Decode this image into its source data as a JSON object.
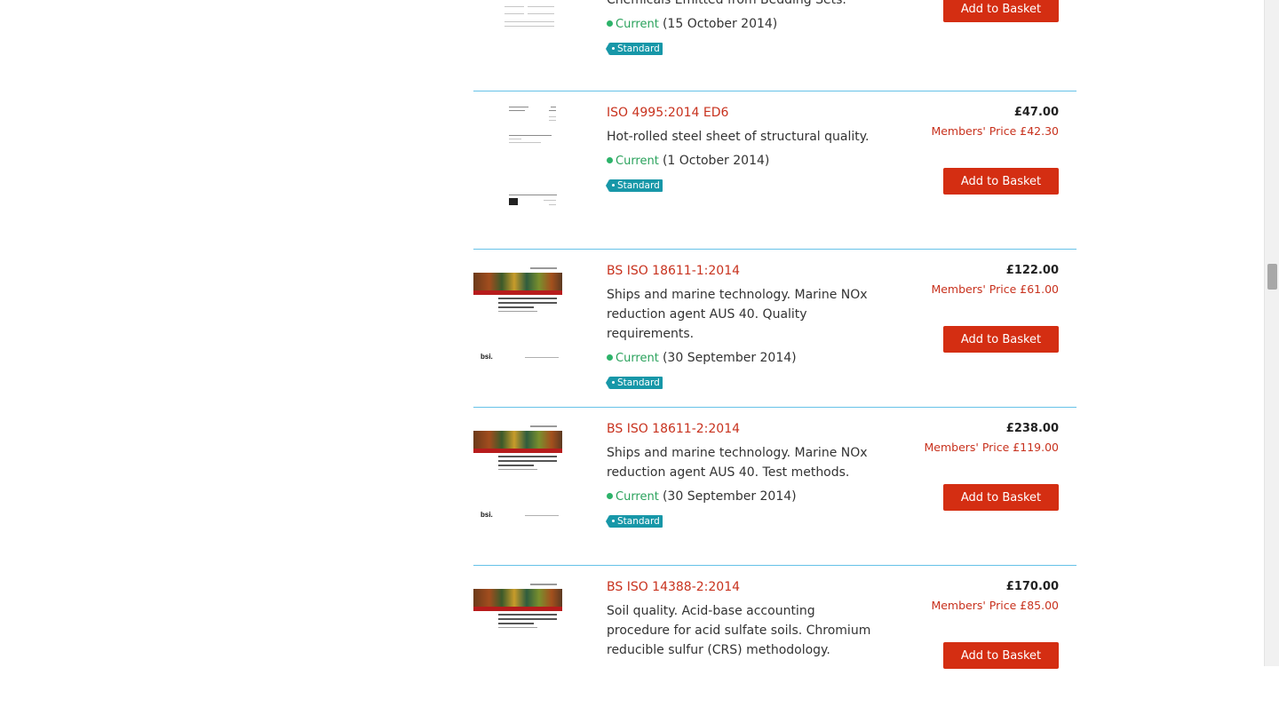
{
  "products": [
    {
      "code": "",
      "description": "Chemicals Emitted from Bedding Sets.",
      "status": "Current",
      "date": "(15 October 2014)",
      "type": "Standard",
      "price": "",
      "members_price": "",
      "button": "Add to Basket",
      "cover": "iso"
    },
    {
      "code": "ISO 4995:2014 ED6",
      "description": "Hot-rolled steel sheet of structural quality.",
      "status": "Current",
      "date": "(1 October 2014)",
      "type": "Standard",
      "price": "£47.00",
      "members_price": "Members' Price £42.30",
      "button": "Add to Basket",
      "cover": "iso"
    },
    {
      "code": "BS ISO 18611-1:2014",
      "description": "Ships and marine technology. Marine NOx reduction agent AUS 40. Quality requirements.",
      "status": "Current",
      "date": "(30 September 2014)",
      "type": "Standard",
      "price": "£122.00",
      "members_price": "Members' Price £61.00",
      "button": "Add to Basket",
      "cover": "bsi",
      "cover_logo": "bsi."
    },
    {
      "code": "BS ISO 18611-2:2014",
      "description": "Ships and marine technology. Marine NOx reduction agent AUS 40. Test methods.",
      "status": "Current",
      "date": "(30 September 2014)",
      "type": "Standard",
      "price": "£238.00",
      "members_price": "Members' Price £119.00",
      "button": "Add to Basket",
      "cover": "bsi",
      "cover_logo": "bsi."
    },
    {
      "code": "BS ISO 14388-2:2014",
      "description": "Soil quality. Acid-base accounting procedure for acid sulfate soils. Chromium reducible sulfur (CRS) methodology.",
      "status": "Current",
      "date": "",
      "type": "",
      "price": "£170.00",
      "members_price": "Members' Price £85.00",
      "button": "Add to Basket",
      "cover": "bsi",
      "cover_logo": ""
    }
  ],
  "colors": {
    "link": "#c8321e",
    "button": "#d42e12",
    "status_green": "#2aa25c",
    "tag_teal": "#1797a8",
    "divider": "#66c2e8"
  }
}
